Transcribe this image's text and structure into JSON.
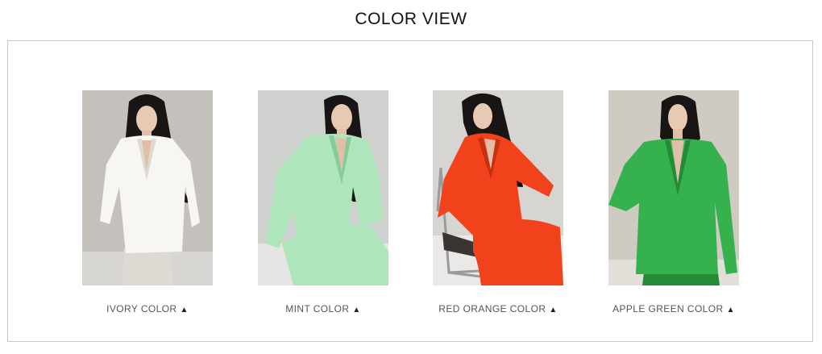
{
  "page_title": "COLOR VIEW",
  "colors": [
    {
      "label": "IVORY COLOR",
      "arrow": "▲",
      "suit": "#f7f6f1",
      "shade": "#dcdad2",
      "bg": "#c4c1bd",
      "bg2": "#d8d6d2"
    },
    {
      "label": "MINT COLOR",
      "arrow": "▲",
      "suit": "#aee5bb",
      "shade": "#86cc99",
      "bg": "#cfd1cf",
      "bg2": "#e4e5e4"
    },
    {
      "label": "RED ORANGE COLOR",
      "arrow": "▲",
      "suit": "#f2421c",
      "shade": "#c7300f",
      "bg": "#d7d5d2",
      "bg2": "#ebe9e7"
    },
    {
      "label": "APPLE GREEN COLOR",
      "arrow": "▲",
      "suit": "#35b14d",
      "shade": "#238a38",
      "bg": "#cfcac2",
      "bg2": "#e2ded8"
    }
  ]
}
